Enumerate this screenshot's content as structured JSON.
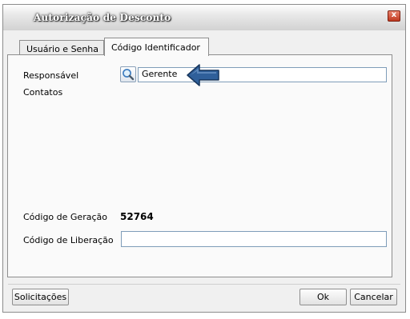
{
  "window": {
    "title": "Autorização de Desconto"
  },
  "tabs": [
    {
      "label": "Usuário e Senha",
      "active": false
    },
    {
      "label": "Código Identificador",
      "active": true
    }
  ],
  "form": {
    "responsavel_label": "Responsável",
    "responsavel_value": "Gerente",
    "contatos_label": "Contatos",
    "codigo_geracao_label": "Código de Geração",
    "codigo_geracao_value": "52764",
    "codigo_liberacao_label": "Código de Liberação",
    "codigo_liberacao_value": ""
  },
  "footer": {
    "solicitacoes_label": "Solicitações",
    "ok_label": "Ok",
    "cancelar_label": "Cancelar"
  },
  "colors": {
    "close_button": "#c0391f",
    "arrow": "#2f5f9a",
    "input_border": "#7f9db9"
  },
  "icons": {
    "search": "search-icon",
    "close": "close-icon",
    "arrow": "arrow-left-icon"
  }
}
